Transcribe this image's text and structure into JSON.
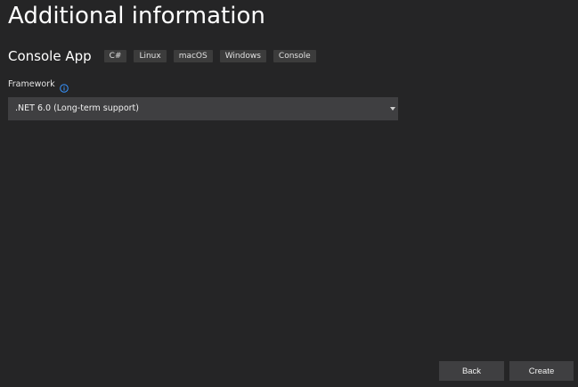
{
  "page": {
    "title": "Additional information"
  },
  "template": {
    "name": "Console App",
    "tags": [
      "C#",
      "Linux",
      "macOS",
      "Windows",
      "Console"
    ]
  },
  "framework": {
    "label": "Framework",
    "info_icon": "info-circle-icon",
    "selected_value": ".NET 6.0 (Long-term support)",
    "dropdown_icon": "chevron-down-icon"
  },
  "buttons": {
    "back_label": "Back",
    "create_label": "Create"
  },
  "colors": {
    "background": "#252526",
    "control_background": "#3f3f41",
    "tag_background": "#3c3c3c",
    "info_accent": "#3794ff"
  }
}
